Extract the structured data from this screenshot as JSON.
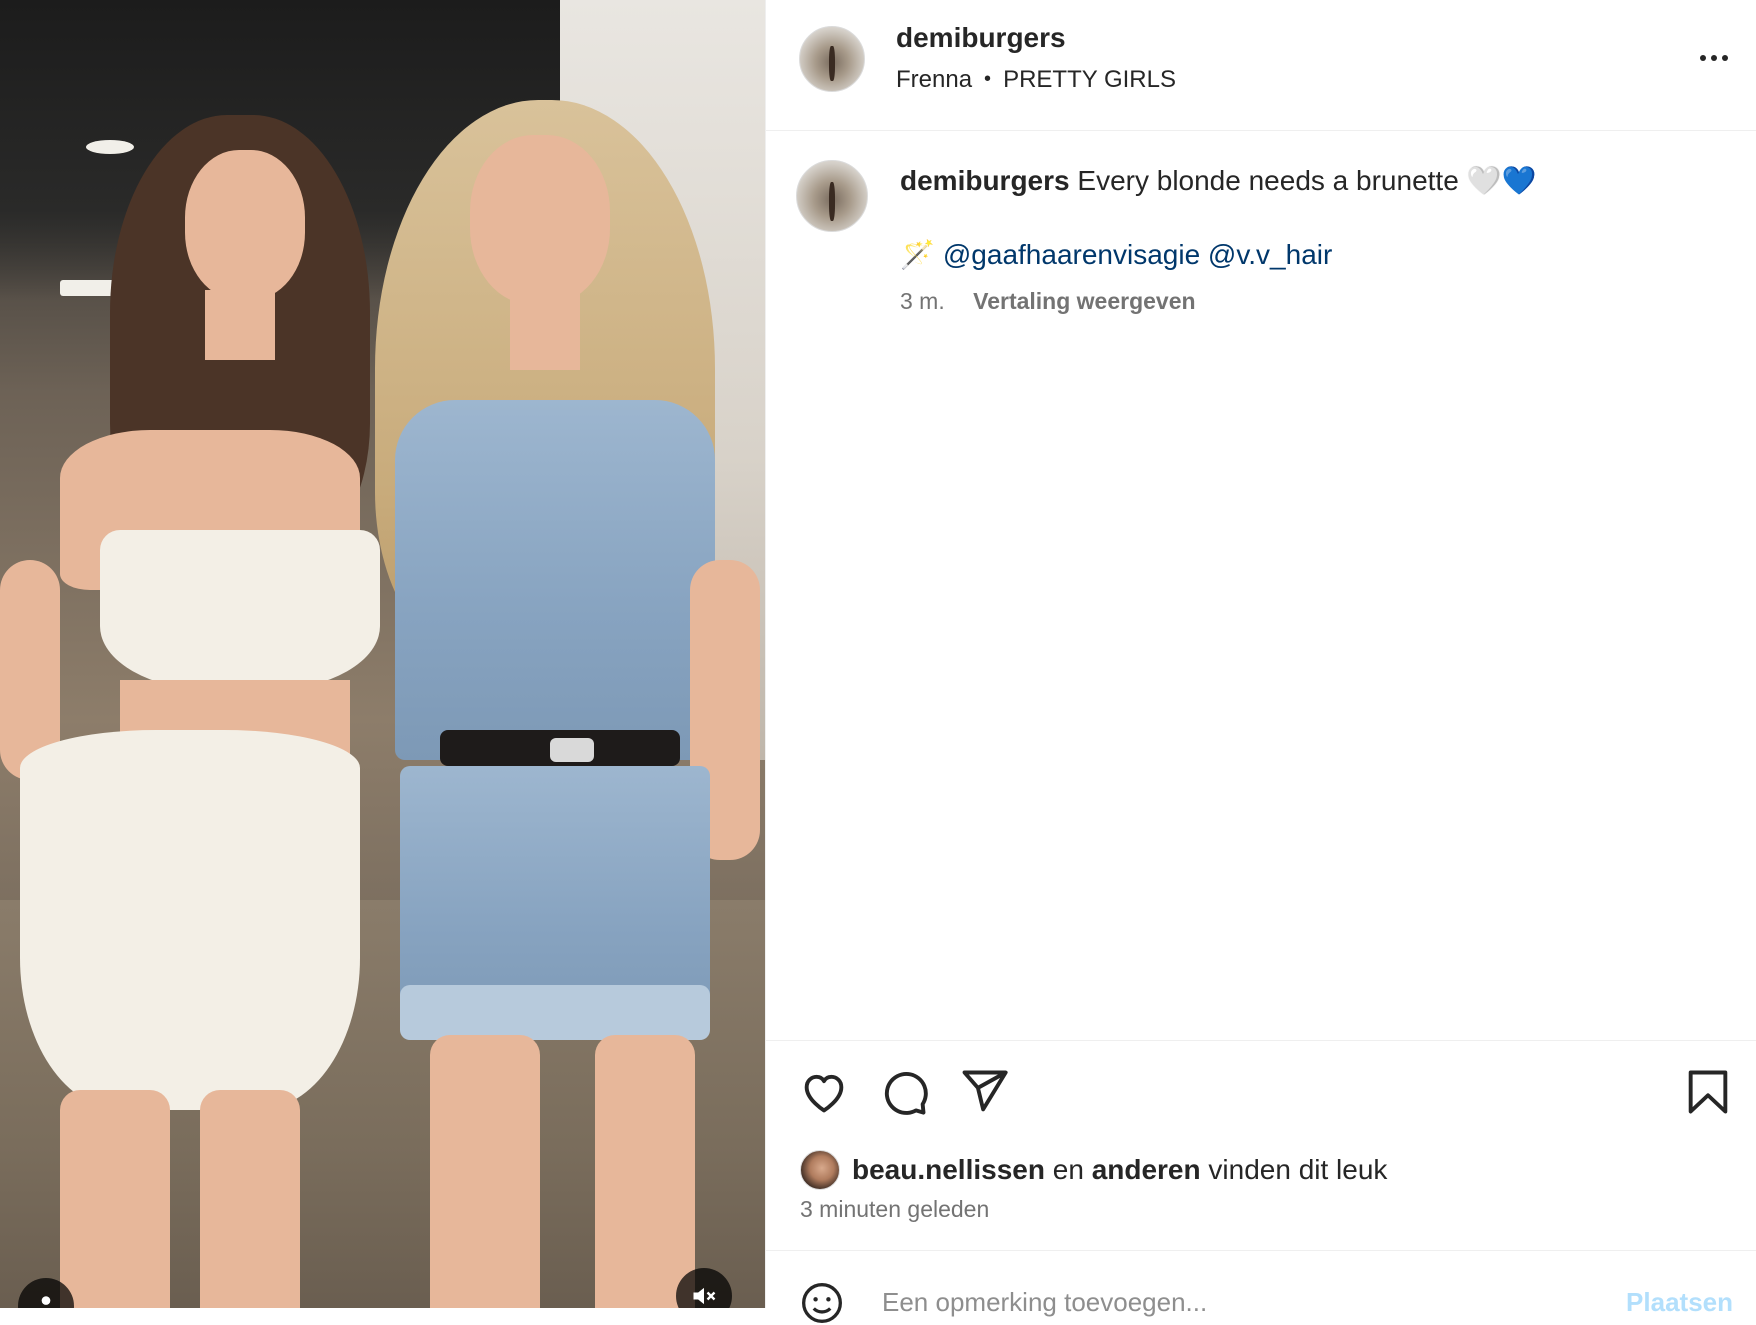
{
  "post": {
    "username": "demiburgers",
    "audio_artist": "Frenna",
    "audio_separator": "•",
    "audio_title": "PRETTY GIRLS",
    "caption_text": "Every blonde needs a brunette",
    "caption_emojis": [
      "🤍",
      "💙"
    ],
    "mentions_wand": "🪄",
    "mentions": [
      "@gaafhaarenvisagie",
      "@v.v_hair"
    ],
    "caption_age": "3 m.",
    "translate_label": "Vertaling weergeven",
    "liked_by_user": "beau.nellissen",
    "liked_by_joiner": "en",
    "liked_by_others": "anderen",
    "liked_by_suffix": "vinden dit leuk",
    "timestamp": "3 minuten geleden",
    "comment_placeholder": "Een opmerking toevoegen...",
    "post_button": "Plaatsen"
  },
  "icons": {
    "more": "more-horizontal-icon",
    "like": "heart-icon",
    "comment": "comment-bubble-icon",
    "share": "paper-plane-icon",
    "save": "bookmark-icon",
    "emoji": "emoji-smile-icon",
    "tag": "person-tag-icon",
    "mute": "speaker-muted-icon"
  },
  "colors": {
    "text": "#262626",
    "secondary_text": "#737373",
    "link": "#00376b",
    "post_button": "#b2dffc",
    "divider": "#efefef"
  }
}
